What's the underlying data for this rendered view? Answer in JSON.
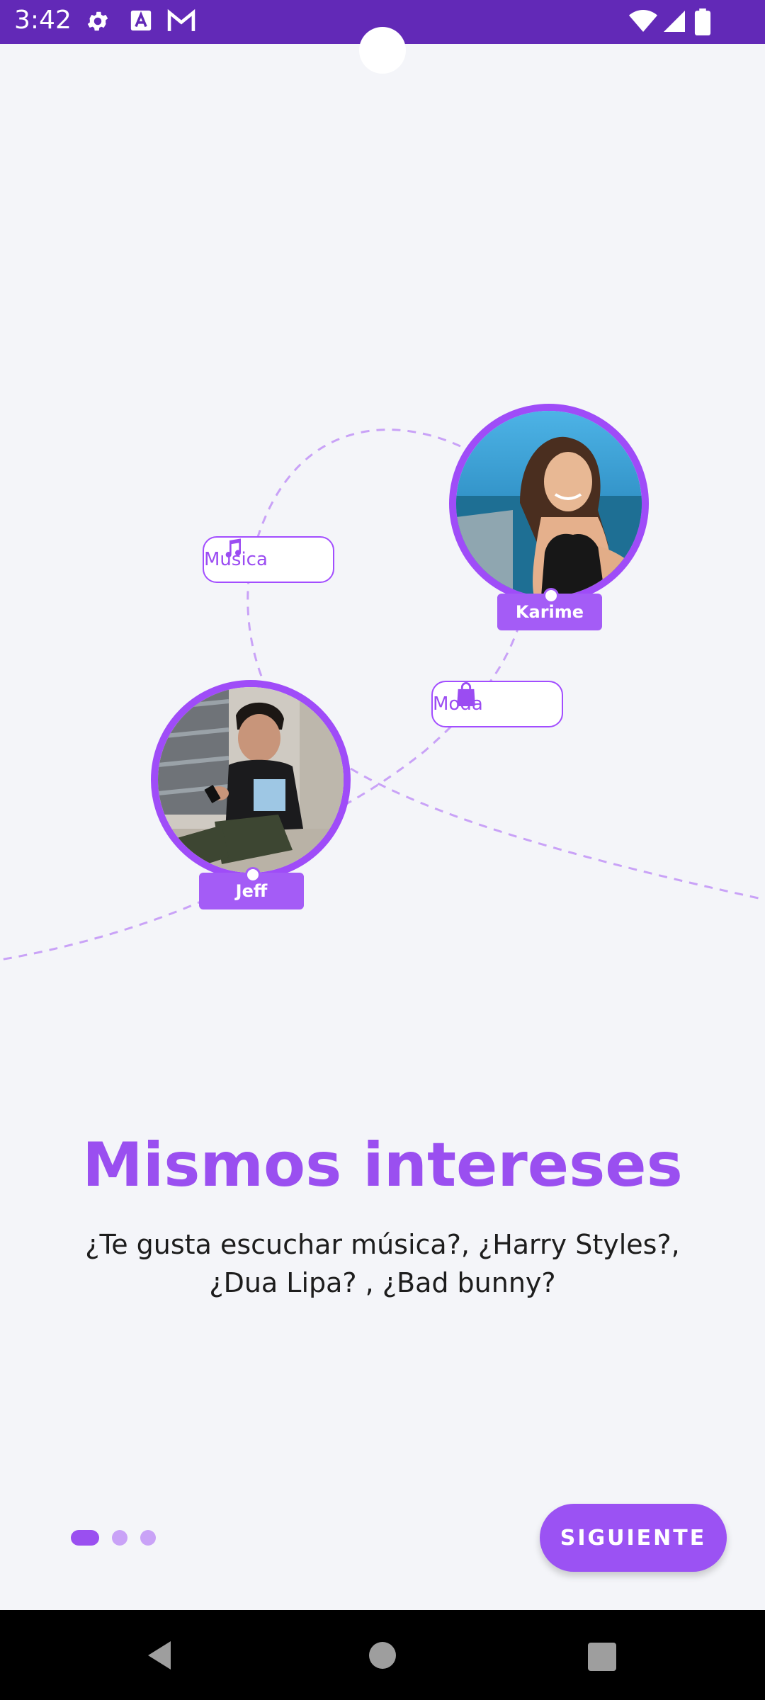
{
  "status_bar": {
    "time": "3:42",
    "icons_left": [
      "gear-icon",
      "a-badge-icon",
      "gmail-icon"
    ],
    "icons_right": [
      "wifi-icon",
      "signal-icon",
      "battery-icon"
    ],
    "background": "#6229b7"
  },
  "illustration": {
    "people": [
      {
        "name": "Karime"
      },
      {
        "name": "Jeff"
      }
    ],
    "interests": [
      {
        "label": "Musica",
        "icon": "music-note-icon"
      },
      {
        "label": "Moda",
        "icon": "shopping-bag-icon"
      }
    ],
    "accent": "#a24dff"
  },
  "content": {
    "title": "Mismos intereses",
    "description": "¿Te gusta escuchar música?, ¿Harry Styles?, ¿Dua Lipa? , ¿Bad bunny?"
  },
  "pager": {
    "total_pages": 3,
    "current_page": 1
  },
  "next_button": {
    "label": "SIGUIENTE"
  },
  "nav_bar": {
    "icons": [
      "back-icon",
      "home-icon",
      "recents-icon"
    ]
  },
  "colors": {
    "accent": "#9a4ff0",
    "background": "#f4f5f9"
  }
}
